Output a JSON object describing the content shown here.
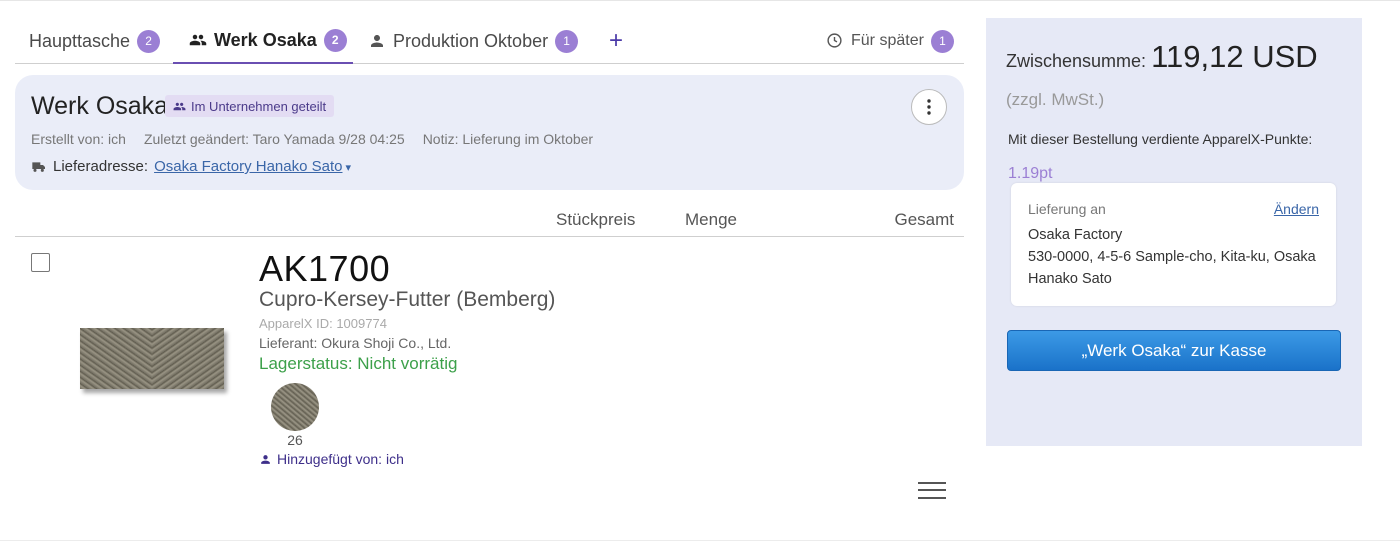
{
  "tabs": [
    {
      "label": "Haupttasche",
      "count": "2"
    },
    {
      "label": "Werk Osaka",
      "count": "2"
    },
    {
      "label": "Produktion Oktober",
      "count": "1"
    }
  ],
  "tab_add_label": "+",
  "later_tab": {
    "label": "Für später",
    "count": "1"
  },
  "cart": {
    "title": "Werk Osaka",
    "shared_label": "Im Unternehmen geteilt",
    "created_by": "Erstellt von: ich",
    "last_changed": "Zuletzt geändert: Taro Yamada 9/28 04:25",
    "note": "Notiz: Lieferung im Oktober",
    "shipping_label": "Lieferadresse:",
    "shipping_address": "Osaka Factory Hanako Sato"
  },
  "columns": {
    "unit_price": "Stückpreis",
    "quantity": "Menge",
    "total": "Gesamt"
  },
  "item": {
    "code": "AK1700",
    "name": "Cupro-Kersey-Futter (Bemberg)",
    "apparelx_id": "ApparelX ID: 1009774",
    "supplier": "Lieferant: Okura Shoji Co., Ltd.",
    "stock": "Lagerstatus: Nicht vorrätig",
    "color_label": "26",
    "added_by": "Hinzugefügt von: ich"
  },
  "summary": {
    "subtotal_label": "Zwischensumme:",
    "subtotal_amount": "119,12 USD",
    "tax_note": "(zzgl. MwSt.)",
    "points_text": "Mit dieser Bestellung verdiente ApparelX-Punkte:",
    "points_value": "1.19pt",
    "ship_to_label": "Lieferung an",
    "change_label": "Ändern",
    "ship_name": "Osaka Factory",
    "ship_address": "530-0000, 4-5-6 Sample-cho, Kita-ku, Osaka",
    "ship_person": "Hanako Sato",
    "checkout_label": "„Werk Osaka“ zur Kasse"
  },
  "colors": {
    "accent_purple": "#9b7fd4",
    "stock_green": "#3ca04a",
    "checkout_blue": "#1a72c9"
  }
}
